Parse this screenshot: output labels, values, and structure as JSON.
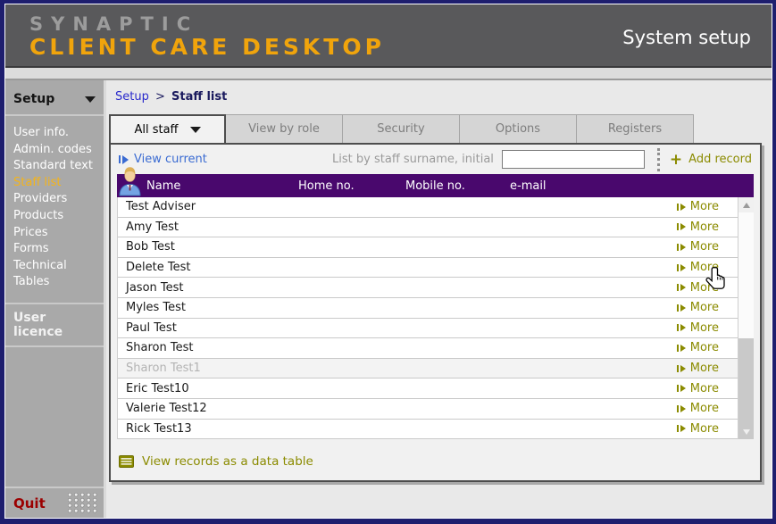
{
  "header": {
    "logo_line1": "SYNAPTIC",
    "logo_line2": "CLIENT CARE DESKTOP",
    "page_title": "System setup"
  },
  "sidebar": {
    "section_title": "Setup",
    "items": [
      {
        "label": "User info.",
        "active": false
      },
      {
        "label": "Admin. codes",
        "active": false
      },
      {
        "label": "Standard text",
        "active": false
      },
      {
        "label": "Staff list",
        "active": true
      },
      {
        "label": "Providers",
        "active": false
      },
      {
        "label": "Products",
        "active": false
      },
      {
        "label": "Prices",
        "active": false
      },
      {
        "label": "Forms",
        "active": false
      },
      {
        "label": "Technical",
        "active": false
      },
      {
        "label": "Tables",
        "active": false
      }
    ],
    "user_licence_label": "User licence",
    "quit_label": "Quit"
  },
  "breadcrumb": {
    "parent": "Setup",
    "separator": ">",
    "current": "Staff list"
  },
  "tabs": [
    {
      "label": "All staff",
      "active": true,
      "has_dropdown": true
    },
    {
      "label": "View by role",
      "active": false,
      "has_dropdown": false
    },
    {
      "label": "Security",
      "active": false,
      "has_dropdown": false
    },
    {
      "label": "Options",
      "active": false,
      "has_dropdown": false
    },
    {
      "label": "Registers",
      "active": false,
      "has_dropdown": false
    }
  ],
  "toolbar": {
    "view_current_label": "View current",
    "list_by_label": "List by staff surname, initial",
    "search_value": "",
    "add_record_icon": "plus-icon",
    "add_record_label": "Add record"
  },
  "table": {
    "columns": [
      "Name",
      "Home no.",
      "Mobile no.",
      "e-mail"
    ],
    "more_label": "More",
    "rows": [
      {
        "name": "Test Adviser",
        "home_no": "",
        "mobile_no": "",
        "email": "",
        "disabled": false
      },
      {
        "name": "Amy Test",
        "home_no": "",
        "mobile_no": "",
        "email": "",
        "disabled": false
      },
      {
        "name": "Bob Test",
        "home_no": "",
        "mobile_no": "",
        "email": "",
        "disabled": false
      },
      {
        "name": "Delete Test",
        "home_no": "",
        "mobile_no": "",
        "email": "",
        "disabled": false
      },
      {
        "name": "Jason Test",
        "home_no": "",
        "mobile_no": "",
        "email": "",
        "disabled": false
      },
      {
        "name": "Myles Test",
        "home_no": "",
        "mobile_no": "",
        "email": "",
        "disabled": false
      },
      {
        "name": "Paul Test",
        "home_no": "",
        "mobile_no": "",
        "email": "",
        "disabled": false
      },
      {
        "name": "Sharon Test",
        "home_no": "",
        "mobile_no": "",
        "email": "",
        "disabled": false
      },
      {
        "name": "Sharon Test1",
        "home_no": "",
        "mobile_no": "",
        "email": "",
        "disabled": true
      },
      {
        "name": "Eric Test10",
        "home_no": "",
        "mobile_no": "",
        "email": "",
        "disabled": false
      },
      {
        "name": "Valerie Test12",
        "home_no": "",
        "mobile_no": "",
        "email": "",
        "disabled": false
      },
      {
        "name": "Rick Test13",
        "home_no": "",
        "mobile_no": "",
        "email": "",
        "disabled": false
      }
    ]
  },
  "footer": {
    "view_records_label": "View records as a data table"
  },
  "cursor": {
    "icon": "hand-pointer"
  },
  "colors": {
    "window_border": "#1e1e6e",
    "header_bg": "#59595b",
    "logo_gray": "#9c9c9c",
    "logo_orange": "#f0a40c",
    "sidebar_bg": "#a9a9a9",
    "sidebar_active_item": "#f4b41a",
    "quit_red": "#9b0000",
    "breadcrumb_link_blue": "#2929cc",
    "action_link_blue": "#3a6bd2",
    "table_header_purple": "#49086d",
    "action_olive": "#8b8b00"
  }
}
